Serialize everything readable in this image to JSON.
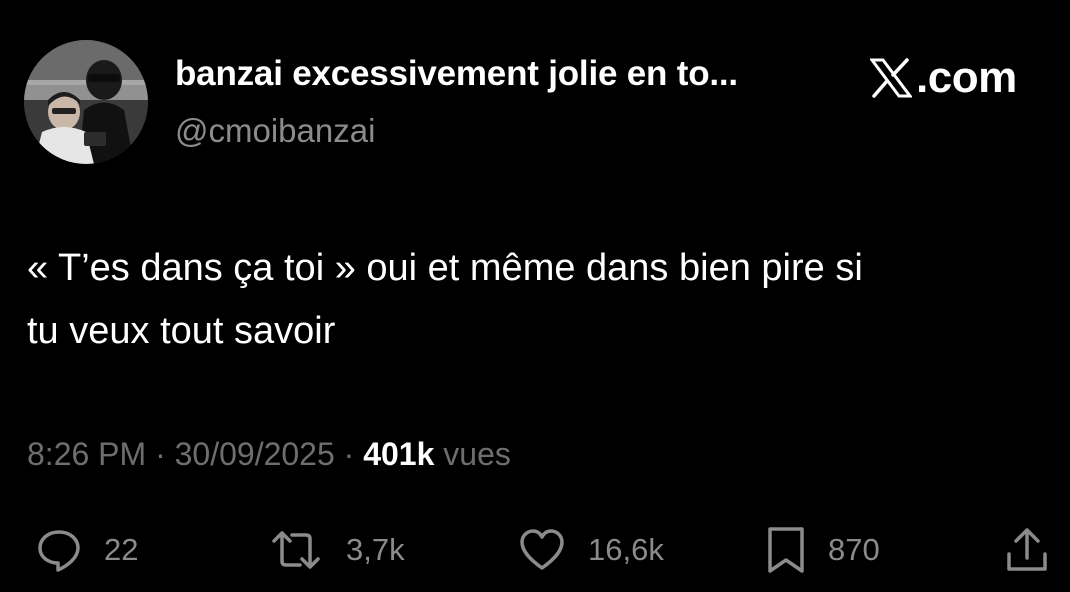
{
  "author": {
    "display_name": "banzai excessivement jolie en to...",
    "handle": "@cmoibanzai",
    "avatar_icon": "profile-photo"
  },
  "brand": {
    "logo_icon": "x-logo-icon",
    "text": ".com"
  },
  "tweet": {
    "text_line1": "« T’es dans ça toi » oui et même dans bien pire si",
    "text_line2": "tu veux tout savoir"
  },
  "meta": {
    "time": "8:26 PM",
    "separator1": " · ",
    "date": "30/09/2025",
    "separator2": " · ",
    "views_count": "401k",
    "views_label": " vues"
  },
  "actions": {
    "replies": {
      "icon": "reply-icon",
      "count": "22"
    },
    "reposts": {
      "icon": "repost-icon",
      "count": "3,7k"
    },
    "likes": {
      "icon": "heart-icon",
      "count": "16,6k"
    },
    "bookmarks": {
      "icon": "bookmark-icon",
      "count": "870"
    },
    "share": {
      "icon": "share-icon"
    }
  },
  "colors": {
    "background": "#000000",
    "primary_text": "#ffffff",
    "secondary_text": "#8b8b8b",
    "meta_text": "#6e6e6e"
  }
}
